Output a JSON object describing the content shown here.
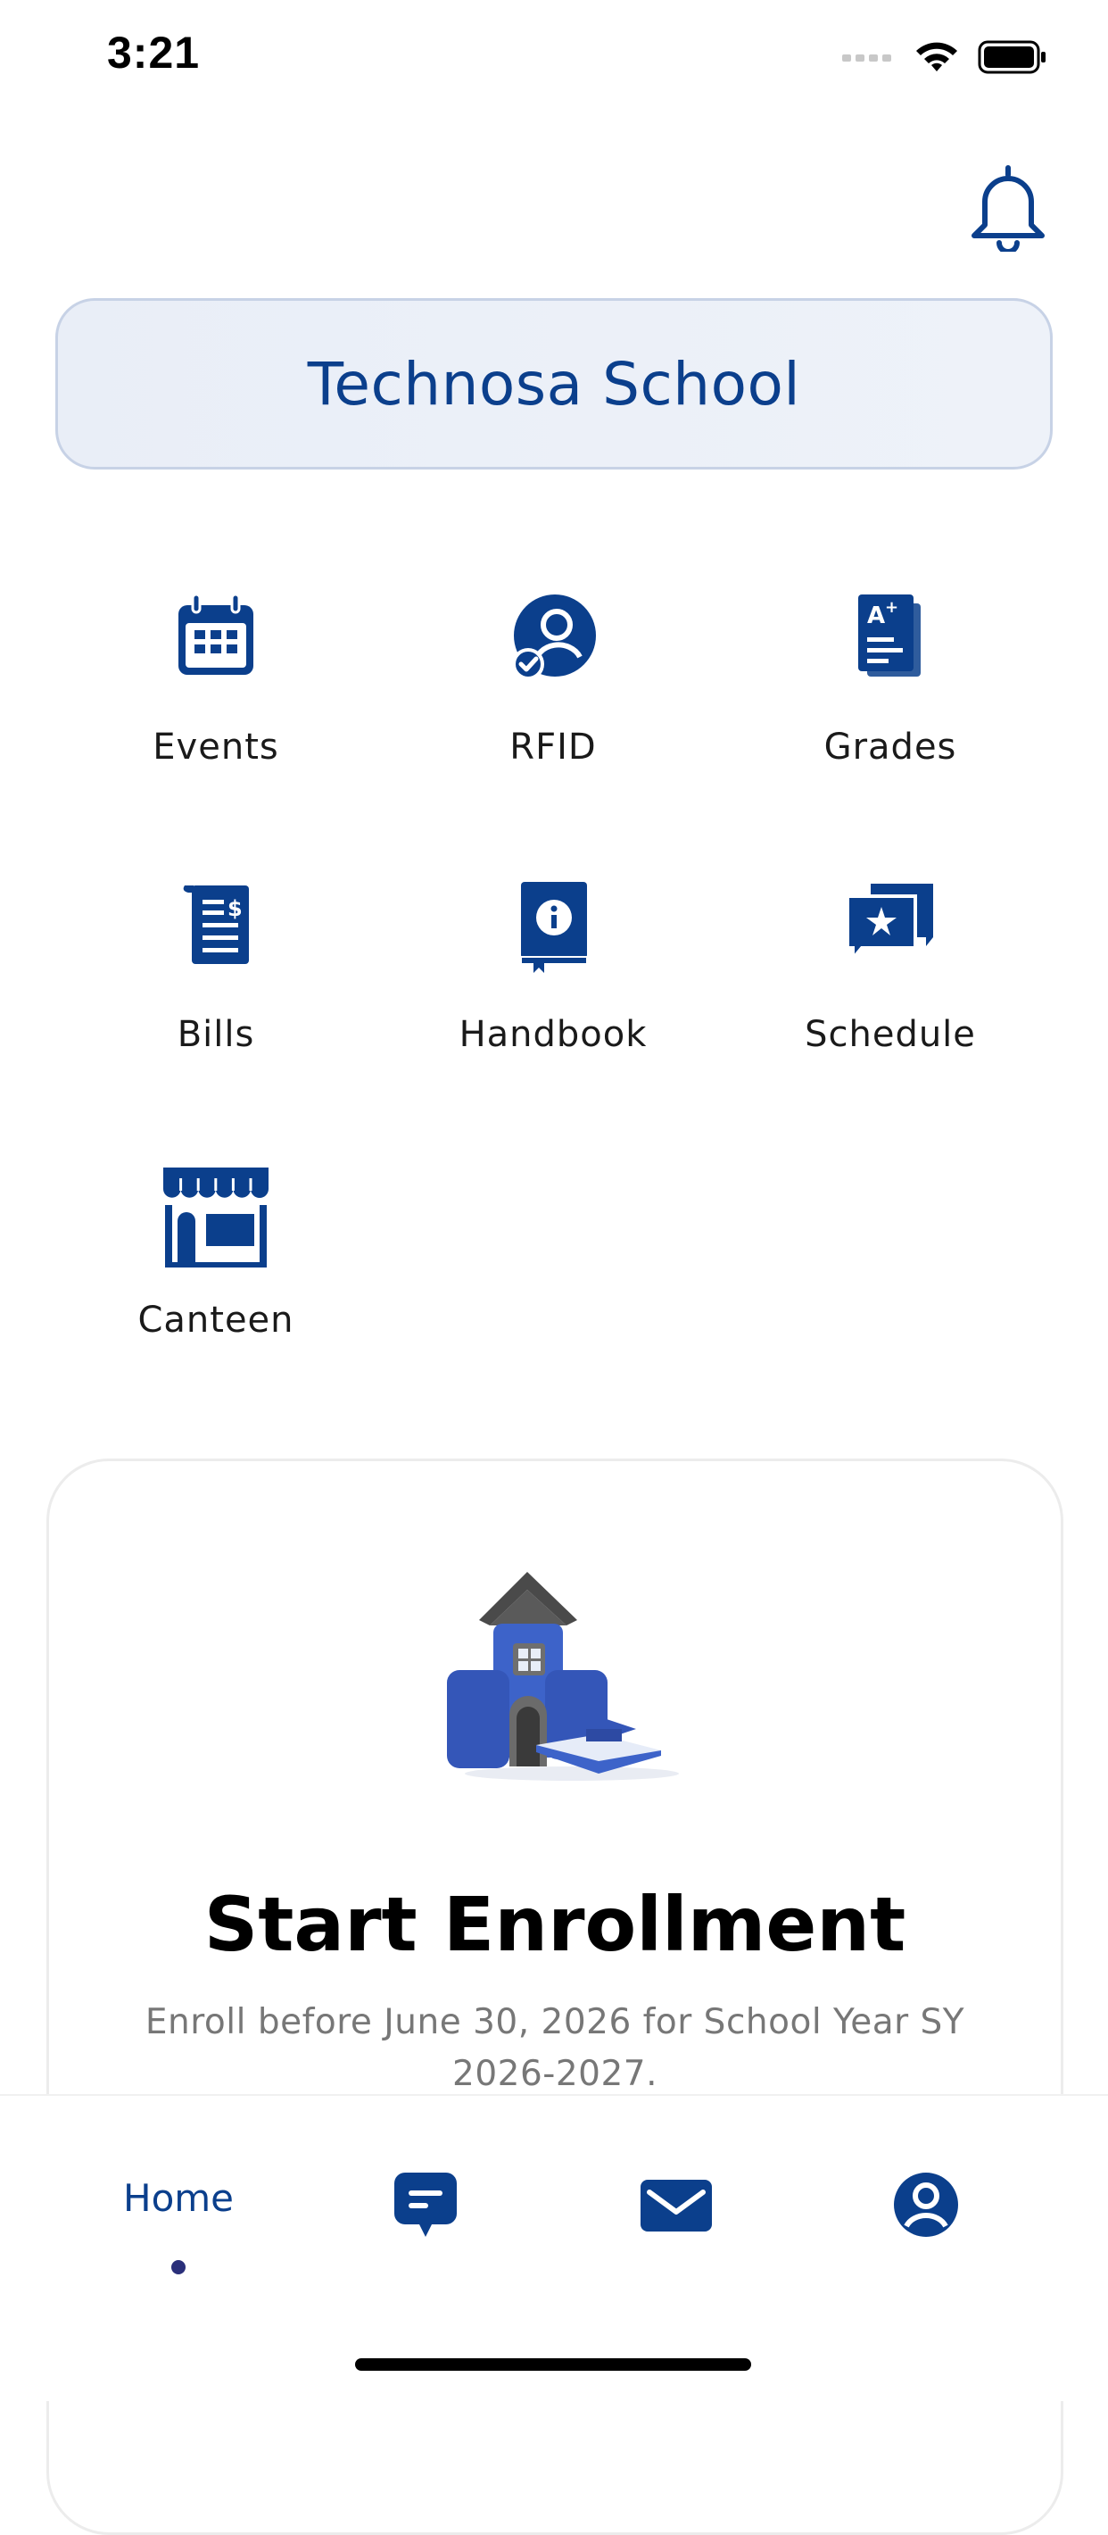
{
  "status_bar": {
    "time": "3:21"
  },
  "header": {
    "notifications_icon": "bell-icon"
  },
  "school": {
    "name": "Technosa School"
  },
  "features": [
    {
      "label": "Events",
      "icon": "calendar-icon"
    },
    {
      "label": "RFID",
      "icon": "user-verified-icon"
    },
    {
      "label": "Grades",
      "icon": "report-card-icon"
    },
    {
      "label": "Bills",
      "icon": "invoice-icon"
    },
    {
      "label": "Handbook",
      "icon": "info-book-icon"
    },
    {
      "label": "Schedule",
      "icon": "chat-star-icon"
    },
    {
      "label": "Canteen",
      "icon": "storefront-icon"
    }
  ],
  "enrollment": {
    "title": "Start Enrollment",
    "description": "Enroll before June 30, 2026 for School Year SY 2026-2027."
  },
  "bottom_nav": {
    "home_label": "Home",
    "items": [
      "home",
      "chat-icon",
      "mail-icon",
      "profile-icon"
    ]
  },
  "colors": {
    "brand": "#0b3f8c",
    "card_bg": "#eef2f9"
  }
}
